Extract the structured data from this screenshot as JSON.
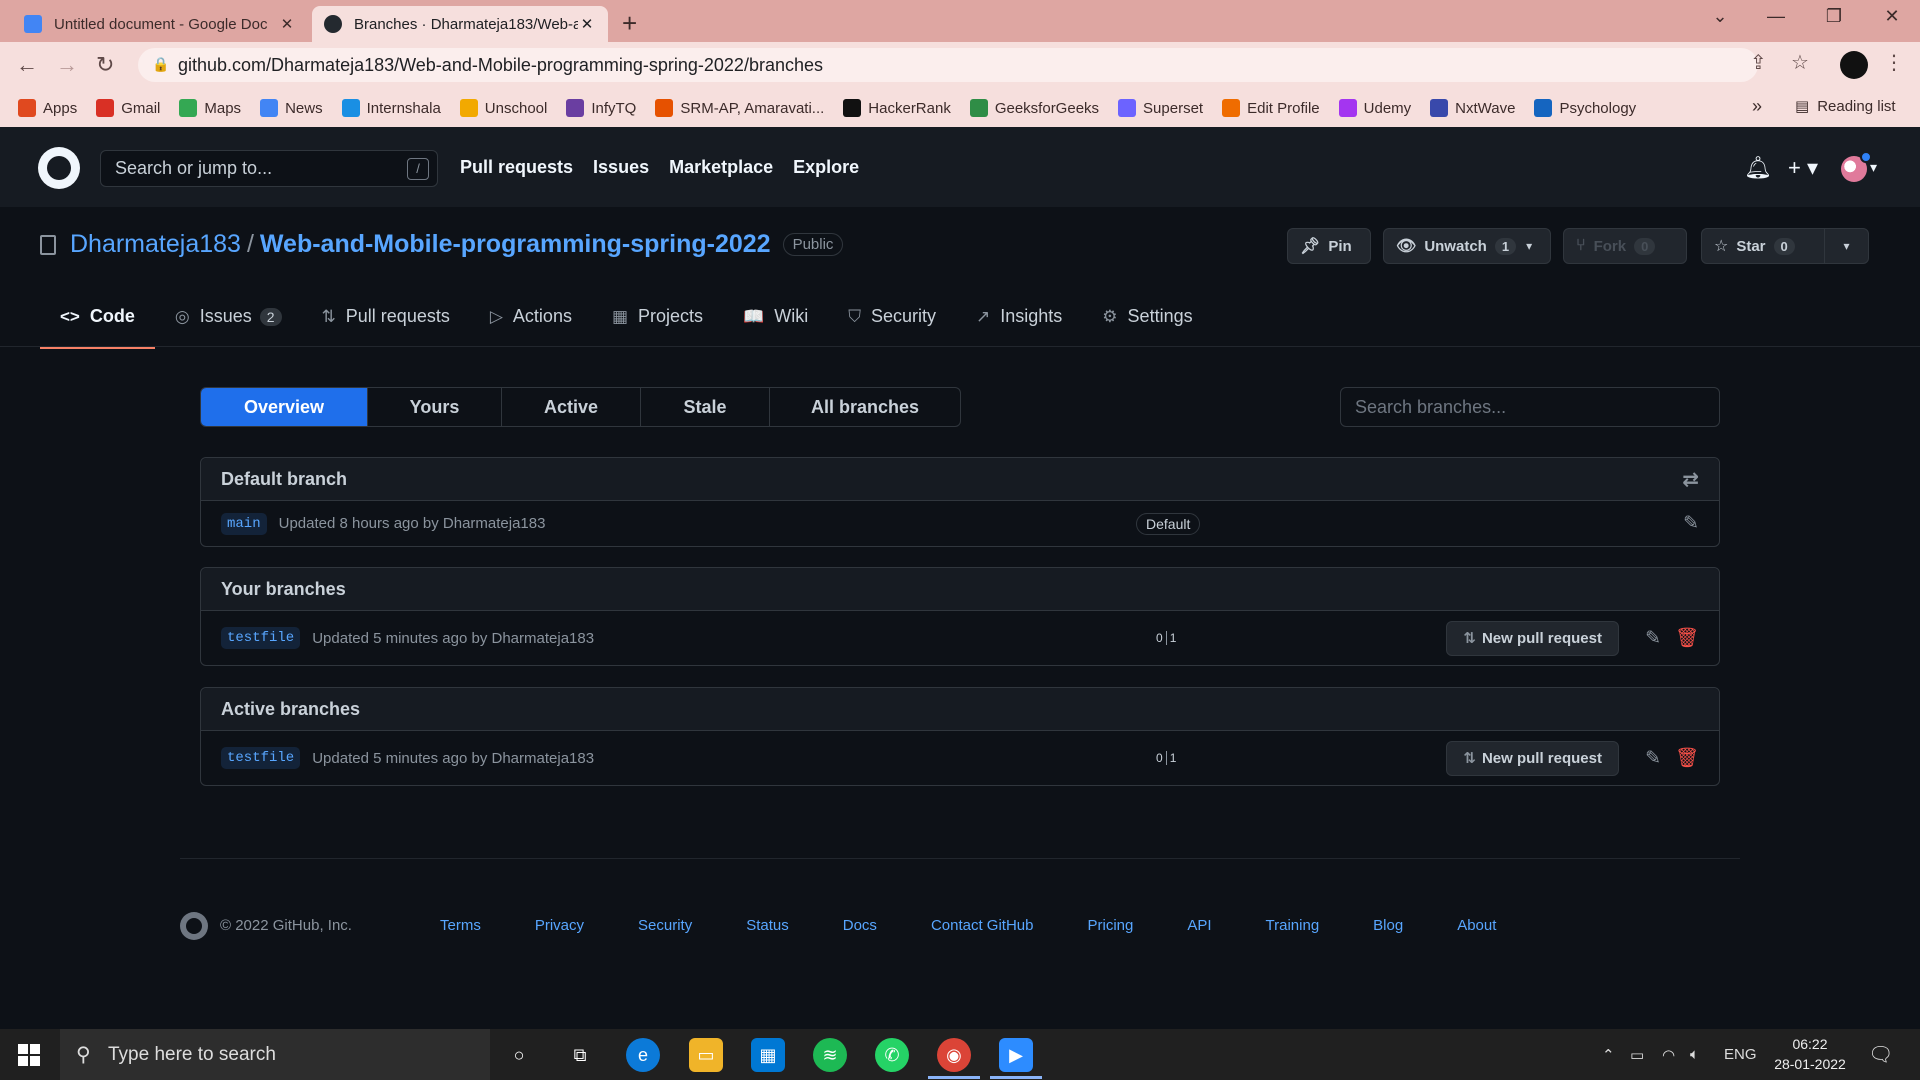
{
  "browser": {
    "tabs": [
      {
        "title": "Untitled document - Google Doc",
        "favicon_color": "#4285f4"
      },
      {
        "title": "Branches · Dharmateja183/Web-a",
        "favicon_color": "#24292f"
      }
    ],
    "url": "github.com/Dharmateja183/Web-and-Mobile-programming-spring-2022/branches",
    "bookmarks": [
      {
        "label": "Apps",
        "color": "#e0491f"
      },
      {
        "label": "Gmail",
        "color": "#d93025"
      },
      {
        "label": "Maps",
        "color": "#34a853"
      },
      {
        "label": "News",
        "color": "#4285f4"
      },
      {
        "label": "Internshala",
        "color": "#1a8fe3"
      },
      {
        "label": "Unschool",
        "color": "#f2a900"
      },
      {
        "label": "InfyTQ",
        "color": "#6a3ea1"
      },
      {
        "label": "SRM-AP, Amaravati...",
        "color": "#e65100"
      },
      {
        "label": "HackerRank",
        "color": "#111111"
      },
      {
        "label": "GeeksforGeeks",
        "color": "#2f8d46"
      },
      {
        "label": "Superset",
        "color": "#6c63ff"
      },
      {
        "label": "Edit Profile",
        "color": "#ef6c00"
      },
      {
        "label": "Udemy",
        "color": "#a435f0"
      },
      {
        "label": "NxtWave",
        "color": "#3949ab"
      },
      {
        "label": "Psychology",
        "color": "#1565c0"
      }
    ],
    "reading_list": "Reading list"
  },
  "github": {
    "search_placeholder": "Search or jump to...",
    "search_key": "/",
    "topnav": [
      "Pull requests",
      "Issues",
      "Marketplace",
      "Explore"
    ]
  },
  "repo": {
    "owner": "Dharmateja183",
    "name": "Web-and-Mobile-programming-spring-2022",
    "visibility": "Public",
    "pin": "Pin",
    "unwatch": "Unwatch",
    "unwatch_count": "1",
    "fork": "Fork",
    "fork_count": "0",
    "star": "Star",
    "star_count": "0",
    "nav": [
      {
        "label": "Code",
        "icon": "<>"
      },
      {
        "label": "Issues",
        "icon": "◎",
        "badge": "2"
      },
      {
        "label": "Pull requests",
        "icon": "⇅"
      },
      {
        "label": "Actions",
        "icon": "▷"
      },
      {
        "label": "Projects",
        "icon": "▦"
      },
      {
        "label": "Wiki",
        "icon": "📖"
      },
      {
        "label": "Security",
        "icon": "⛉"
      },
      {
        "label": "Insights",
        "icon": "↗"
      },
      {
        "label": "Settings",
        "icon": "⚙"
      }
    ]
  },
  "branches": {
    "tabs": [
      "Overview",
      "Yours",
      "Active",
      "Stale",
      "All branches"
    ],
    "search_placeholder": "Search branches...",
    "default_section": {
      "title": "Default branch",
      "branch": "main",
      "updated": "Updated 8 hours ago by Dharmateja183",
      "label": "Default"
    },
    "your_section": {
      "title": "Your branches",
      "branch": "testfile",
      "updated": "Updated 5 minutes ago by Dharmateja183",
      "behind": "0",
      "ahead": "1",
      "pr_button": "New pull request"
    },
    "active_section": {
      "title": "Active branches",
      "branch": "testfile",
      "updated": "Updated 5 minutes ago by Dharmateja183",
      "behind": "0",
      "ahead": "1",
      "pr_button": "New pull request"
    }
  },
  "footer": {
    "copyright": "© 2022 GitHub, Inc.",
    "links": [
      "Terms",
      "Privacy",
      "Security",
      "Status",
      "Docs",
      "Contact GitHub",
      "Pricing",
      "API",
      "Training",
      "Blog",
      "About"
    ]
  },
  "taskbar": {
    "search_placeholder": "Type here to search",
    "lang": "ENG",
    "time": "06:22",
    "date": "28-01-2022"
  }
}
